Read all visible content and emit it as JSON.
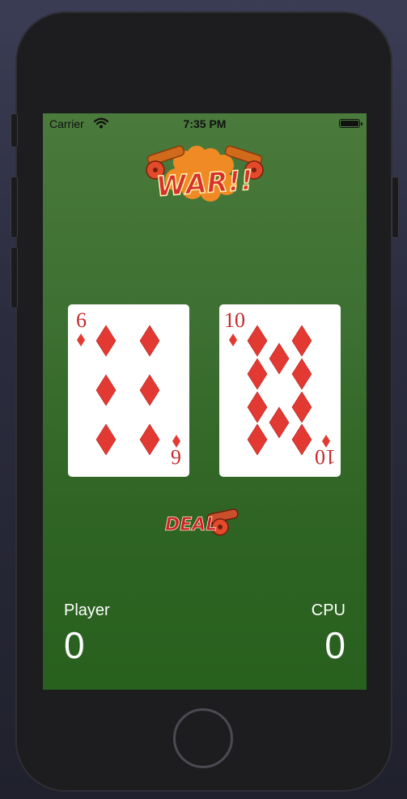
{
  "status_bar": {
    "carrier": "Carrier",
    "time": "7:35 PM"
  },
  "logo": {
    "text": "WAR!!"
  },
  "cards": {
    "player": {
      "rank": "6",
      "suit": "diamonds",
      "pips": 6
    },
    "cpu": {
      "rank": "10",
      "suit": "diamonds",
      "pips": 10
    }
  },
  "deal_button": {
    "label": "DEAL"
  },
  "scores": {
    "player_label": "Player",
    "player_value": "0",
    "cpu_label": "CPU",
    "cpu_value": "0"
  },
  "colors": {
    "suit_red": "#c8282a",
    "table_green": "#3d7032",
    "logo_orange": "#f08a24"
  }
}
